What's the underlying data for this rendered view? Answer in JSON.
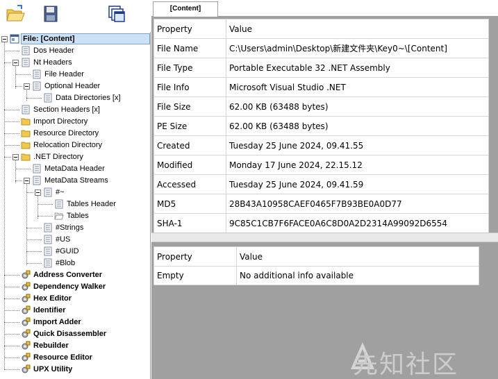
{
  "toolbar": {
    "buttons": [
      {
        "name": "open-file-button",
        "icon": "folder-open-icon"
      },
      {
        "name": "save-file-button",
        "icon": "floppy-disk-icon"
      },
      {
        "name": "windows-button",
        "icon": "windows-stack-icon"
      }
    ]
  },
  "tree": {
    "root": "File: [Content]",
    "items": [
      {
        "label": "Dos Header"
      },
      {
        "label": "Nt Headers"
      },
      {
        "label": "File Header"
      },
      {
        "label": "Optional Header"
      },
      {
        "label": "Data Directories [x]"
      },
      {
        "label": "Section Headers [x]"
      },
      {
        "label": "Import Directory"
      },
      {
        "label": "Resource Directory"
      },
      {
        "label": "Relocation Directory"
      },
      {
        "label": ".NET Directory"
      },
      {
        "label": "MetaData Header"
      },
      {
        "label": "MetaData Streams"
      },
      {
        "label": "#~"
      },
      {
        "label": "Tables Header"
      },
      {
        "label": "Tables"
      },
      {
        "label": "#Strings"
      },
      {
        "label": "#US"
      },
      {
        "label": "#GUID"
      },
      {
        "label": "#Blob"
      }
    ],
    "tools": [
      "Address Converter",
      "Dependency Walker",
      "Hex Editor",
      "Identifier",
      "Import Adder",
      "Quick Disassembler",
      "Rebuilder",
      "Resource Editor",
      "UPX Utility"
    ]
  },
  "tab": {
    "label": "[Content]"
  },
  "properties": {
    "headers": [
      "Property",
      "Value"
    ],
    "rows": [
      [
        "File Name",
        "C:\\Users\\admin\\Desktop\\新建文件夹\\Key0~\\[Content]"
      ],
      [
        "File Type",
        "Portable Executable 32 .NET Assembly"
      ],
      [
        "File Info",
        "Microsoft Visual Studio .NET"
      ],
      [
        "File Size",
        "62.00 KB (63488 bytes)"
      ],
      [
        "PE Size",
        "62.00 KB (63488 bytes)"
      ],
      [
        "Created",
        "Tuesday 25 June 2024, 09.41.55"
      ],
      [
        "Modified",
        "Monday 17 June 2024, 22.15.12"
      ],
      [
        "Accessed",
        "Tuesday 25 June 2024, 09.41.59"
      ],
      [
        "MD5",
        "28B43A10958CAEF0465F7B93BE0A0D77"
      ],
      [
        "SHA-1",
        "9C85C1CB7F6FACE0A6C8D0A2D2314A99092D6554"
      ]
    ]
  },
  "extra_info": {
    "headers": [
      "Property",
      "Value"
    ],
    "rows": [
      [
        "Empty",
        "No additional info available"
      ]
    ]
  },
  "watermark": {
    "text": "先知社区"
  },
  "colors": {
    "selection": "#cde2f6",
    "pane_bg": "#a0a0a0",
    "folder": "#f2c94c"
  }
}
